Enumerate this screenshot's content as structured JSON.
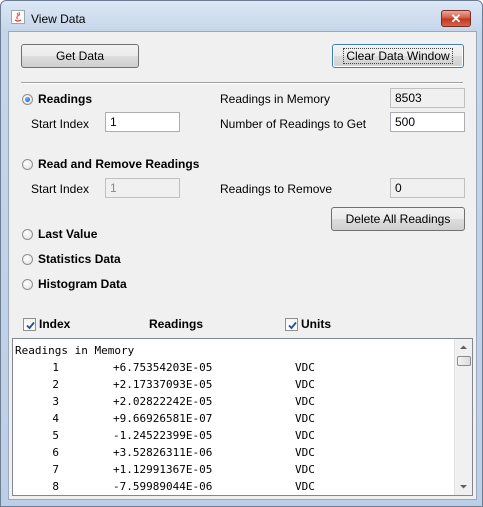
{
  "window": {
    "title": "View Data",
    "close_glyph": "✕"
  },
  "buttons": {
    "get_data": "Get Data",
    "clear_data_window": "Clear Data Window",
    "delete_all_readings": "Delete All Readings"
  },
  "modes": {
    "readings": {
      "label": "Readings",
      "selected": true,
      "start_index_label": "Start Index",
      "start_index_value": "1",
      "in_memory_label": "Readings in Memory",
      "in_memory_value": "8503",
      "num_to_get_label": "Number of Readings to Get",
      "num_to_get_value": "500"
    },
    "read_remove": {
      "label": "Read and Remove Readings",
      "selected": false,
      "start_index_label": "Start Index",
      "start_index_value": "1",
      "to_remove_label": "Readings to Remove",
      "to_remove_value": "0"
    },
    "last_value": {
      "label": "Last Value",
      "selected": false
    },
    "statistics": {
      "label": "Statistics Data",
      "selected": false
    },
    "histogram": {
      "label": "Histogram Data",
      "selected": false
    }
  },
  "columns": {
    "index_label": "Index",
    "index_checked": true,
    "readings_label": "Readings",
    "units_label": "Units",
    "units_checked": true
  },
  "output": {
    "header": "Readings in Memory",
    "rows": [
      {
        "index": "1",
        "value": "+6.75354203E-05",
        "unit": "VDC"
      },
      {
        "index": "2",
        "value": "+2.17337093E-05",
        "unit": "VDC"
      },
      {
        "index": "3",
        "value": "+2.02822242E-05",
        "unit": "VDC"
      },
      {
        "index": "4",
        "value": "+9.66926581E-07",
        "unit": "VDC"
      },
      {
        "index": "5",
        "value": "-1.24522399E-05",
        "unit": "VDC"
      },
      {
        "index": "6",
        "value": "+3.52826311E-06",
        "unit": "VDC"
      },
      {
        "index": "7",
        "value": "+1.12991367E-05",
        "unit": "VDC"
      },
      {
        "index": "8",
        "value": "-7.59989044E-06",
        "unit": "VDC"
      }
    ]
  }
}
